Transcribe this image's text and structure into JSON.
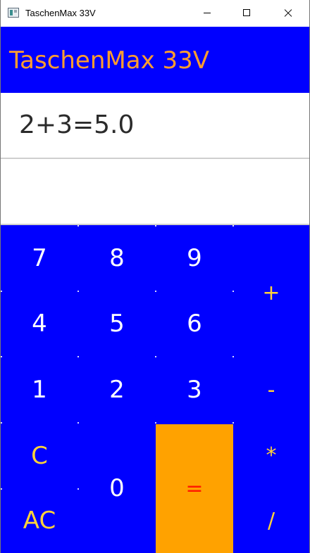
{
  "window": {
    "title": "TaschenMax 33V"
  },
  "header": {
    "title": "TaschenMax 33V"
  },
  "display": {
    "expression": "2+3=5.0",
    "result": ""
  },
  "keypad": {
    "digits": [
      "7",
      "8",
      "9",
      "4",
      "5",
      "6",
      "1",
      "2",
      "3",
      "0"
    ],
    "operators": [
      "+",
      "-",
      "*",
      "/"
    ],
    "clear": "C",
    "all_clear": "AC",
    "equals": "="
  },
  "colors": {
    "header_bg": "#0000ff",
    "title_color": "#ff9d2e",
    "keypad_bg": "#0000ff",
    "operator_color": "#ffd23a",
    "equals_bg": "#ffa200",
    "equals_text": "#ff1a00"
  }
}
